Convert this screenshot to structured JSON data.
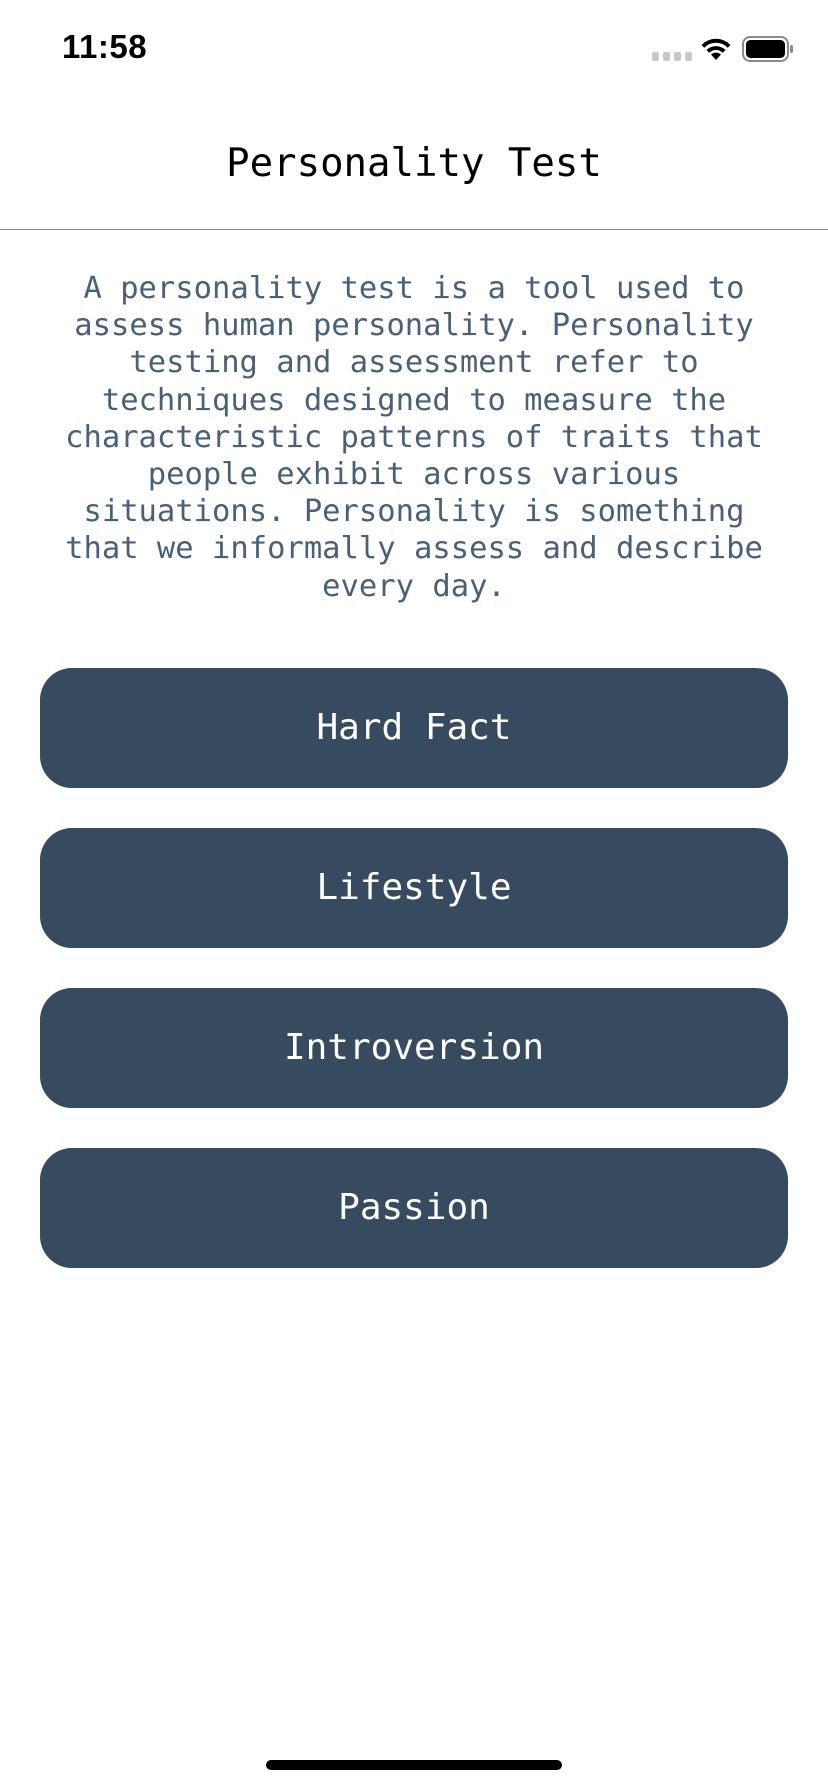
{
  "status_bar": {
    "time": "11:58",
    "icons": [
      "cellular-signal-icon",
      "wifi-icon",
      "battery-icon"
    ]
  },
  "header": {
    "title": "Personality Test"
  },
  "main": {
    "description": "A personality test is a tool used to assess human personality. Personality testing and assessment refer to techniques designed to measure the characteristic patterns of traits that people exhibit across various situations. Personality is something that we informally assess and describe every day.",
    "buttons": [
      {
        "label": "Hard Fact"
      },
      {
        "label": "Lifestyle"
      },
      {
        "label": "Introversion"
      },
      {
        "label": "Passion"
      }
    ]
  },
  "colors": {
    "button_background": "#364a60",
    "button_text": "#ffffff",
    "description_text": "#48607a",
    "divider": "#7d8790"
  }
}
